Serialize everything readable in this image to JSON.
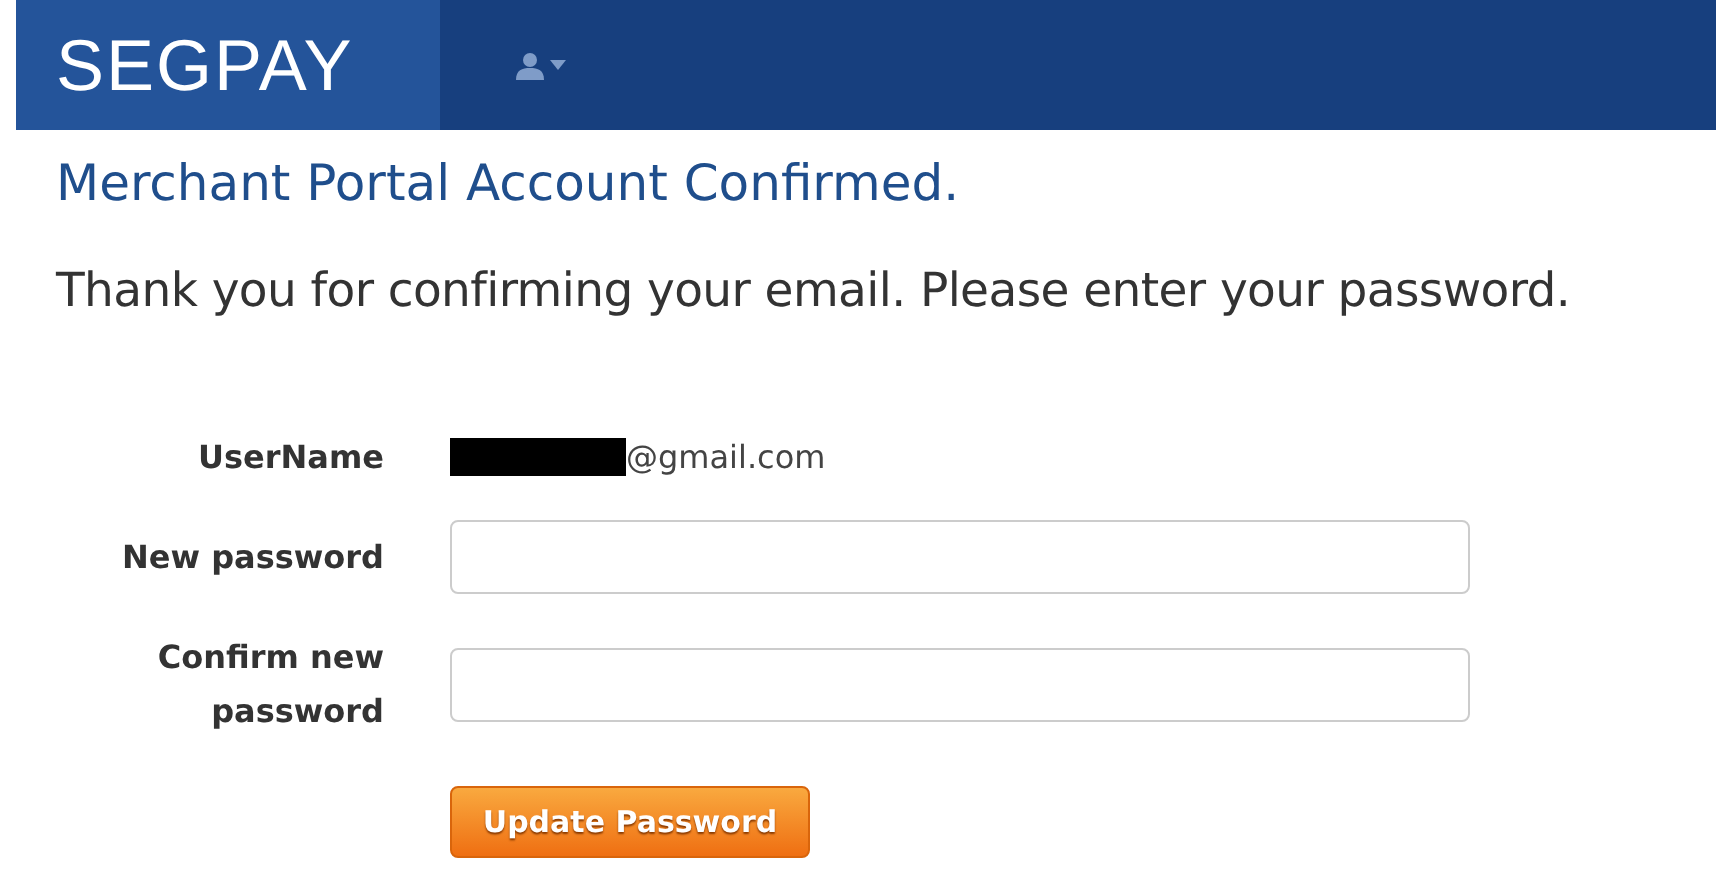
{
  "header": {
    "logo": "SEGPAY"
  },
  "title": "Merchant Portal Account Confirmed.",
  "message": "Thank you for confirming your email. Please enter your password.",
  "form": {
    "fields": [
      {
        "kind": "static",
        "label": "UserName",
        "redacted": true,
        "value": "@gmail.com"
      },
      {
        "kind": "password",
        "label": "New password"
      },
      {
        "kind": "password",
        "label": "Confirm new password"
      }
    ],
    "submit": "Update Password"
  }
}
